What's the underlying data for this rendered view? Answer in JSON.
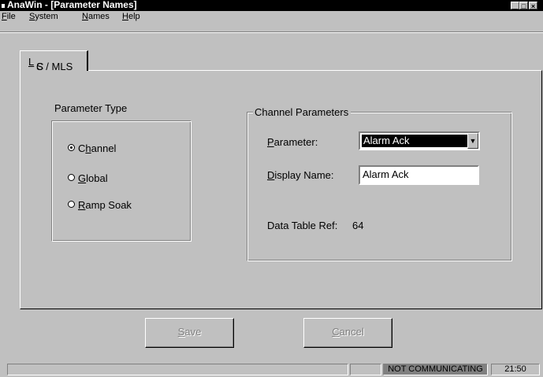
{
  "window": {
    "title": "AnaWin - [Parameter Names]",
    "min_glyph": "_",
    "max_glyph": "□",
    "close_glyph": "×"
  },
  "menu": [
    {
      "pre": "",
      "mn": "F",
      "post": "ile"
    },
    {
      "pre": "",
      "mn": "S",
      "post": "ystem"
    },
    {
      "pre": "",
      "mn": "N",
      "post": "ames"
    },
    {
      "pre": "",
      "mn": "H",
      "post": "elp"
    }
  ],
  "tab": {
    "pre": "C",
    "mn": "L",
    "post": "S / MLS"
  },
  "parameter_type": {
    "label": "Parameter Type",
    "options": [
      {
        "pre": "C",
        "mn": "h",
        "post": "annel",
        "selected": true
      },
      {
        "pre": "",
        "mn": "G",
        "post": "lobal",
        "selected": false
      },
      {
        "pre": "",
        "mn": "R",
        "post": "amp Soak",
        "selected": false
      }
    ]
  },
  "channel_parameters": {
    "label": "Channel Parameters",
    "parameter_label": {
      "pre": "",
      "mn": "P",
      "post": "arameter:"
    },
    "parameter_value": "Alarm Ack",
    "display_label": {
      "pre": "",
      "mn": "D",
      "post": "isplay Name:"
    },
    "display_value": "Alarm Ack",
    "data_table_ref_label": "Data Table Ref:",
    "data_table_ref_value": "64"
  },
  "buttons": {
    "save": {
      "pre": "",
      "mn": "S",
      "post": "ave"
    },
    "cancel": {
      "pre": "",
      "mn": "C",
      "post": "ancel"
    }
  },
  "status": {
    "communication": "NOT COMMUNICATING",
    "time": "21:50"
  },
  "colors": {
    "face": "#c0c0c0",
    "title_bg": "#000000",
    "selection": "#000000",
    "disabled_text": "#808080"
  }
}
